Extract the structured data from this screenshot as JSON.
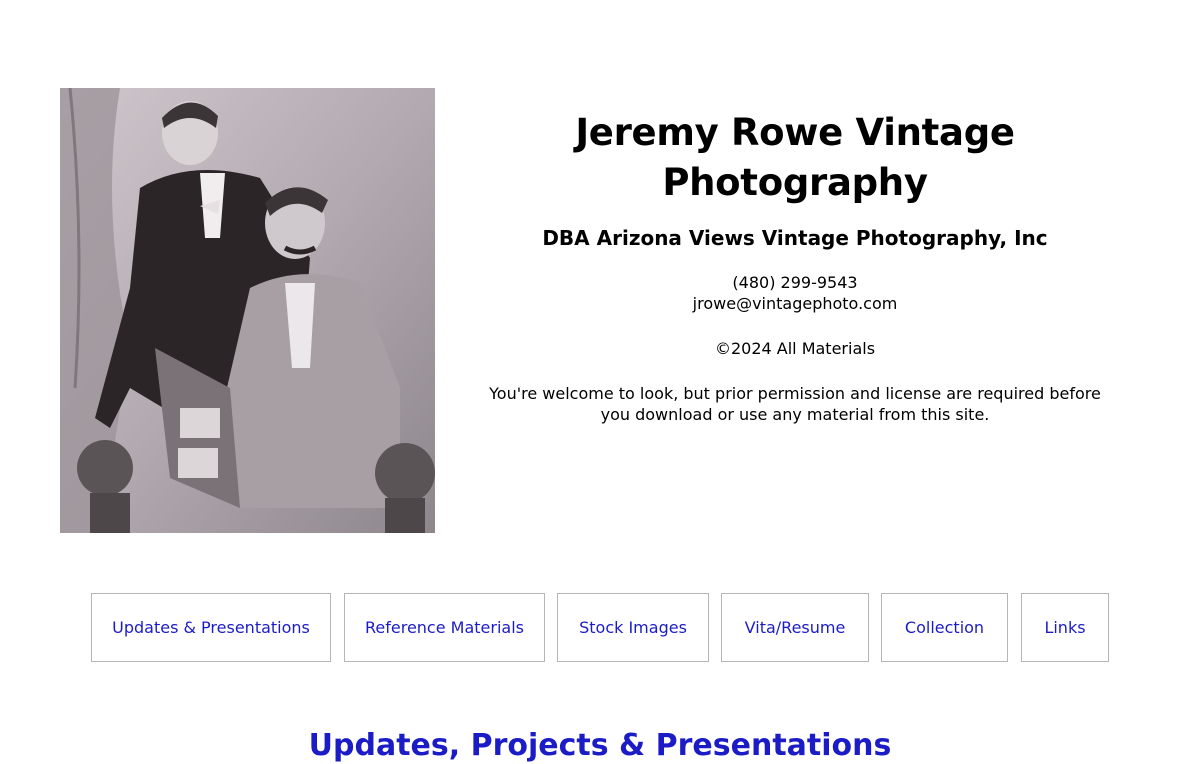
{
  "header": {
    "title": "Jeremy Rowe Vintage Photography",
    "subtitle": "DBA Arizona Views Vintage Photography, Inc",
    "phone": "(480) 299-9543",
    "email": "jrowe@vintagephoto.com",
    "copyright": "©2024 All Materials",
    "notice": "You're welcome to look, but prior permission and license are required before you download or use any material from this site."
  },
  "nav": {
    "items": [
      {
        "label": "Updates & Presentations"
      },
      {
        "label": "Reference Materials"
      },
      {
        "label": "Stock Images"
      },
      {
        "label": "Vita/Resume"
      },
      {
        "label": "Collection"
      },
      {
        "label": "Links"
      }
    ]
  },
  "section": {
    "heading": "Updates, Projects & Presentations"
  },
  "colors": {
    "link": "#1c1cc7",
    "border": "#b6b6b6",
    "photo_tone": "#b9b3b8"
  }
}
